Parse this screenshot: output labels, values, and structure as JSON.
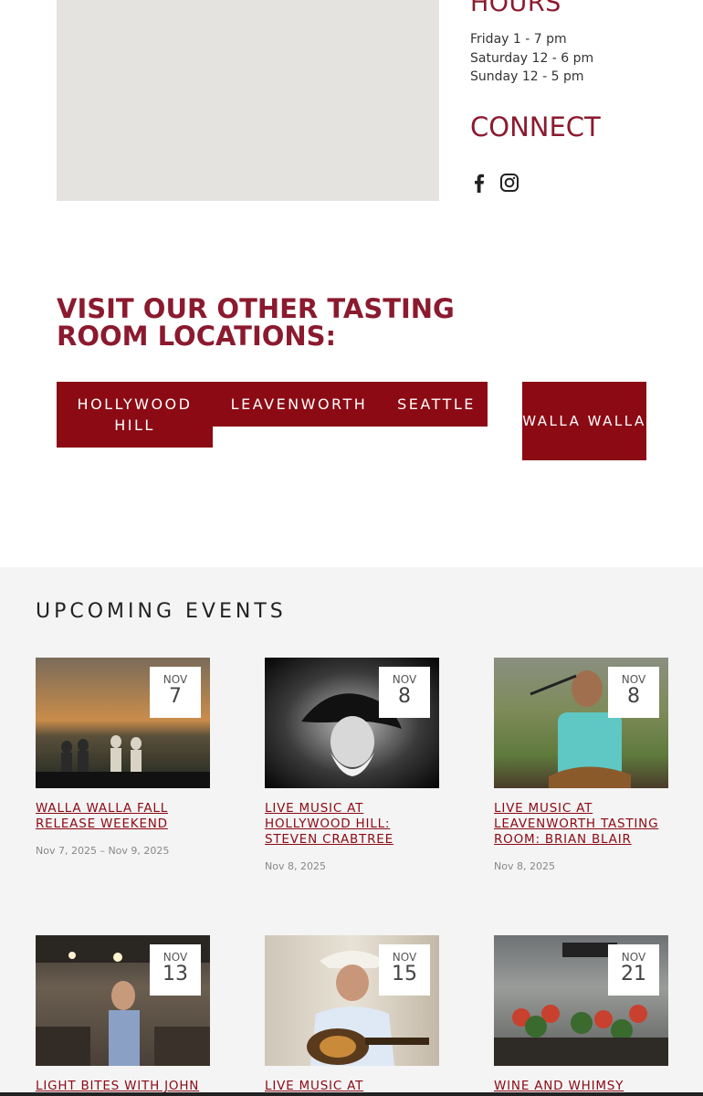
{
  "hours": {
    "title": "HOURS",
    "lines": [
      "Friday 1 - 7  pm",
      "Saturday 12 - 6 pm",
      "Sunday 12 - 5 pm"
    ]
  },
  "connect": {
    "title": "CONNECT",
    "icons": [
      "facebook-icon",
      "instagram-icon"
    ]
  },
  "visit": {
    "title": "VISIT OUR OTHER TASTING ROOM LOCATIONS:",
    "locations": [
      "HOLLYWOOD HILL",
      "LEAVENWORTH",
      "SEATTLE",
      "WALLA WALLA"
    ]
  },
  "events": {
    "title": "UPCOMING EVENTS",
    "items": [
      {
        "month": "NOV",
        "day": "7",
        "title": "WALLA WALLA FALL RELEASE WEEKEND",
        "date": "Nov 7, 2025 – Nov 9, 2025"
      },
      {
        "month": "NOV",
        "day": "8",
        "title": "LIVE MUSIC AT HOLLYWOOD HILL: STEVEN CRABTREE",
        "date": "Nov 8, 2025"
      },
      {
        "month": "NOV",
        "day": "8",
        "title": "LIVE MUSIC AT LEAVENWORTH TASTING ROOM: BRIAN BLAIR",
        "date": "Nov 8, 2025"
      },
      {
        "month": "NOV",
        "day": "13",
        "title": "LIGHT BITES WITH JOHN",
        "date": ""
      },
      {
        "month": "NOV",
        "day": "15",
        "title": "LIVE MUSIC AT",
        "date": ""
      },
      {
        "month": "NOV",
        "day": "21",
        "title": "WINE AND WHIMSY",
        "date": ""
      }
    ]
  },
  "colors": {
    "accent": "#8b0a14",
    "heading": "#8b1a2e",
    "section_bg": "#f4f4f4"
  }
}
